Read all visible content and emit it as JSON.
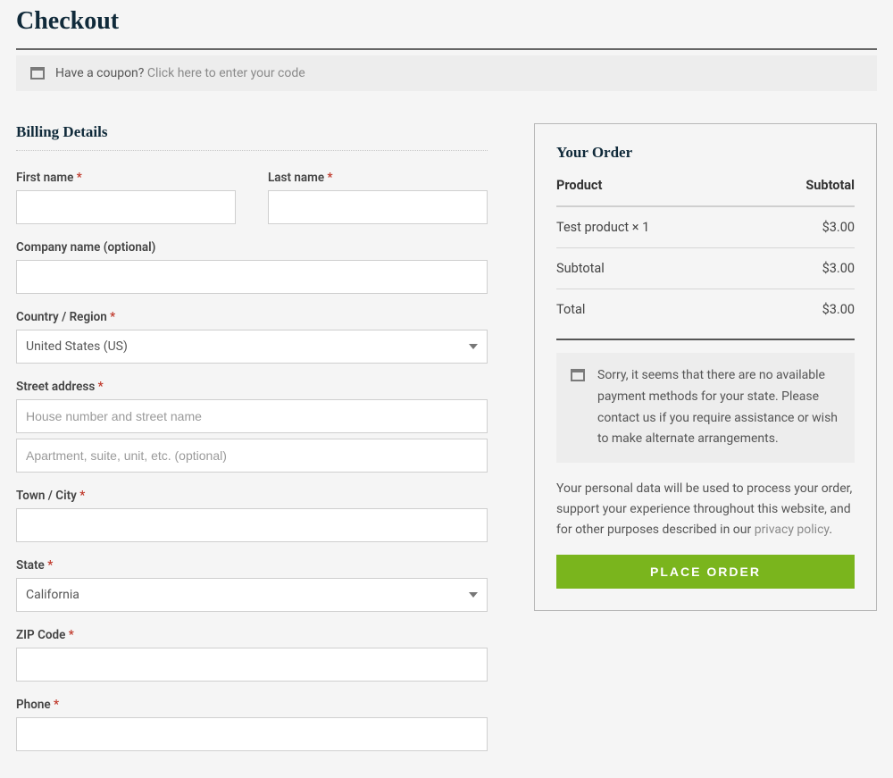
{
  "page": {
    "title": "Checkout"
  },
  "coupon": {
    "prompt": "Have a coupon? ",
    "link": "Click here to enter your code"
  },
  "billing": {
    "title": "Billing Details",
    "first_name_label": "First name ",
    "last_name_label": "Last name ",
    "company_label": "Company name (optional)",
    "country_label": "Country / Region ",
    "country_value": "United States (US)",
    "street_label": "Street address ",
    "street_ph1": "House number and street name",
    "street_ph2": "Apartment, suite, unit, etc. (optional)",
    "city_label": "Town / City ",
    "state_label": "State ",
    "state_value": "California",
    "zip_label": "ZIP Code ",
    "phone_label": "Phone "
  },
  "order": {
    "title": "Your Order",
    "head_product": "Product",
    "head_subtotal": "Subtotal",
    "item_name": "Test product × 1",
    "item_price": "$3.00",
    "subtotal_label": "Subtotal",
    "subtotal_value": "$3.00",
    "total_label": "Total",
    "total_value": "$3.00",
    "notice": "Sorry, it seems that there are no available payment methods for your state. Please contact us if you require assistance or wish to make alternate arrangements.",
    "privacy_pre": "Your personal data will be used to process your order, support your experience throughout this website, and for other purposes described in our ",
    "privacy_link": "privacy policy",
    "privacy_post": ".",
    "place_order": "PLACE ORDER"
  }
}
